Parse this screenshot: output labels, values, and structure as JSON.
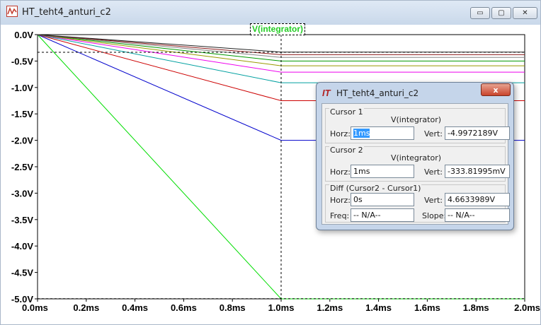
{
  "window": {
    "title": "HT_teht4_anturi_c2",
    "buttons": {
      "minimize": "▭",
      "maximize": "▢",
      "close": "✕"
    }
  },
  "plot": {
    "trace_name": "V(integrator)",
    "y_ticks": [
      "0.0V",
      "-0.5V",
      "-1.0V",
      "-1.5V",
      "-2.0V",
      "-2.5V",
      "-3.0V",
      "-3.5V",
      "-4.0V",
      "-4.5V",
      "-5.0V"
    ],
    "x_ticks": [
      "0.0ms",
      "0.2ms",
      "0.4ms",
      "0.6ms",
      "0.8ms",
      "1.0ms",
      "1.2ms",
      "1.4ms",
      "1.6ms",
      "1.8ms",
      "2.0ms"
    ]
  },
  "chart_data": {
    "type": "line",
    "title": "V(integrator)",
    "xlabel": "",
    "ylabel": "",
    "xlim": [
      0,
      2.0
    ],
    "ylim": [
      -5.0,
      0.0
    ],
    "x_unit": "ms",
    "y_unit": "V",
    "grid": false,
    "series": [
      {
        "color": "#00dd00",
        "x": [
          0,
          1.0,
          2.0
        ],
        "y": [
          0,
          -5.0,
          -5.0
        ]
      },
      {
        "color": "#0000cc",
        "x": [
          0,
          1.0,
          2.0
        ],
        "y": [
          0,
          -2.0,
          -2.0
        ]
      },
      {
        "color": "#cc0000",
        "x": [
          0,
          1.0,
          2.0
        ],
        "y": [
          0,
          -1.25,
          -1.25
        ]
      },
      {
        "color": "#00a0a0",
        "x": [
          0,
          1.0,
          2.0
        ],
        "y": [
          0,
          -0.91,
          -0.91
        ]
      },
      {
        "color": "#ee00ee",
        "x": [
          0,
          1.0,
          2.0
        ],
        "y": [
          0,
          -0.71,
          -0.71
        ]
      },
      {
        "color": "#999900",
        "x": [
          0,
          1.0,
          2.0
        ],
        "y": [
          0,
          -0.59,
          -0.59
        ]
      },
      {
        "color": "#009900",
        "x": [
          0,
          1.0,
          2.0
        ],
        "y": [
          0,
          -0.5,
          -0.5
        ]
      },
      {
        "color": "#888888",
        "x": [
          0,
          1.0,
          2.0
        ],
        "y": [
          0,
          -0.43,
          -0.43
        ]
      },
      {
        "color": "#8b1a1a",
        "x": [
          0,
          1.0,
          2.0
        ],
        "y": [
          0,
          -0.38,
          -0.38
        ]
      },
      {
        "color": "#222222",
        "x": [
          0,
          1.0,
          2.0
        ],
        "y": [
          0,
          -0.33,
          -0.33
        ]
      }
    ],
    "cursors": [
      {
        "x": 1.0,
        "y": -4.9972189
      },
      {
        "x": 1.0,
        "y": -0.33381995
      }
    ]
  },
  "dialog": {
    "title": "HT_teht4_anturi_c2",
    "close": "x",
    "cursor1": {
      "title": "Cursor 1",
      "trace": "V(integrator)",
      "horz_label": "Horz:",
      "horz": "1ms",
      "vert_label": "Vert:",
      "vert": "-4.9972189V"
    },
    "cursor2": {
      "title": "Cursor 2",
      "trace": "V(integrator)",
      "horz_label": "Horz:",
      "horz": "1ms",
      "vert_label": "Vert:",
      "vert": "-333.81995mV"
    },
    "diff": {
      "title": "Diff (Cursor2 - Cursor1)",
      "horz_label": "Horz:",
      "horz": "0s",
      "vert_label": "Vert:",
      "vert": "4.6633989V",
      "freq_label": "Freq:",
      "freq": "-- N/A--",
      "slope_label": "Slope:",
      "slope": "-- N/A--"
    }
  }
}
